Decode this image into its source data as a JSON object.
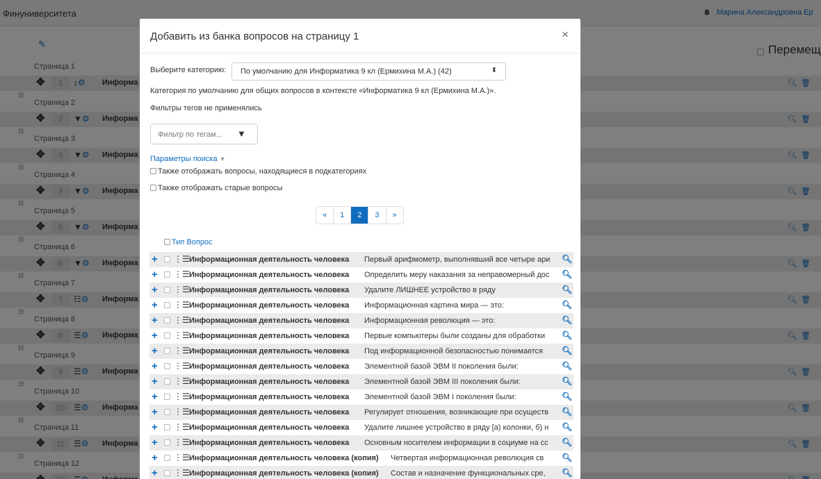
{
  "background": {
    "site_name": "Финуниверситета",
    "user_name": "Марина Александровна Ер",
    "move_label": "Перемещ",
    "pages": [
      {
        "label": "Страница 1",
        "num": "1",
        "title": "Информа"
      },
      {
        "label": "Страница 2",
        "num": "2",
        "title": "Информа"
      },
      {
        "label": "Страница 3",
        "num": "3",
        "title": "Информа"
      },
      {
        "label": "Страница 4",
        "num": "4",
        "title": "Информа"
      },
      {
        "label": "Страница 5",
        "num": "5",
        "title": "Информа"
      },
      {
        "label": "Страница 6",
        "num": "6",
        "title": "Информа"
      },
      {
        "label": "Страница 7",
        "num": "7",
        "title": "Информа"
      },
      {
        "label": "Страница 8",
        "num": "8",
        "title": "Информа"
      },
      {
        "label": "Страница 9",
        "num": "9",
        "title": "Информа"
      },
      {
        "label": "Страница 10",
        "num": "10",
        "title": "Информа"
      },
      {
        "label": "Страница 11",
        "num": "11",
        "title": "Информа"
      },
      {
        "label": "Страница 12",
        "num": "12",
        "title": "Информа"
      }
    ]
  },
  "modal": {
    "title": "Добавить из банка вопросов на страницу 1",
    "close": "×",
    "category_label": "Выберите категорию:",
    "category_value": "По умолчанию для Информатика 9 кл (Ермихина М.А.) (42)",
    "category_desc": "Категория по умолчанию для общих вопросов в контексте «Информатика 9 кл (Ермихина М.А.)».",
    "tag_note": "Фильтры тегов не применялись",
    "tag_filter_placeholder": "Фильтр по тегам...",
    "search_params": "Параметры поиска",
    "show_subcategories": "Также отображать вопросы, находящиеся в подкатегориях",
    "show_old": "Также отображать старые вопросы",
    "pagination": [
      "«",
      "1",
      "2",
      "3",
      "»"
    ],
    "pagination_active": "2",
    "col_type": "Тип",
    "col_question": "Вопрос",
    "questions": [
      {
        "category": "Информационная деятельность человека",
        "text": "Первый арифмометр, выполнявший все четыре ари"
      },
      {
        "category": "Информационная деятельность человека",
        "text": "Определить меру наказания за неправомерный дос"
      },
      {
        "category": "Информационная деятельность человека",
        "text": "Удалите ЛИШНЕЕ устройство в ряду"
      },
      {
        "category": "Информационная деятельность человека",
        "text": "Информационная картина мира — это:"
      },
      {
        "category": "Информационная деятельность человека",
        "text": "Информационная революция — это:"
      },
      {
        "category": "Информационная деятельность человека",
        "text": "Первые компьютеры были созданы для обработки"
      },
      {
        "category": "Информационная деятельность человека",
        "text": "Под информационной безопасностью понимается"
      },
      {
        "category": "Информационная деятельность человека",
        "text": "Элементной базой ЭВМ II поколения были:"
      },
      {
        "category": "Информационная деятельность человека",
        "text": "Элементной базой ЭВМ III поколения были:"
      },
      {
        "category": "Информационная деятельность человека",
        "text": "Элементной базой ЭВМ I поколения были:"
      },
      {
        "category": "Информационная деятельность человека",
        "text": "Регулирует отношения, возникающие при осуществ"
      },
      {
        "category": "Информационная деятельность человека",
        "text": "Удалите лишнее устройство в ряду [а) колонки, б) н"
      },
      {
        "category": "Информационная деятельность человека",
        "text": "Основным носителем информации в социуме на сс"
      },
      {
        "category": "Информационная деятельность человека (копия)",
        "text": "Четвертая информационная революция св"
      },
      {
        "category": "Информационная деятельность человека (копия)",
        "text": "Состав и назначение функциональных сре,"
      }
    ]
  }
}
